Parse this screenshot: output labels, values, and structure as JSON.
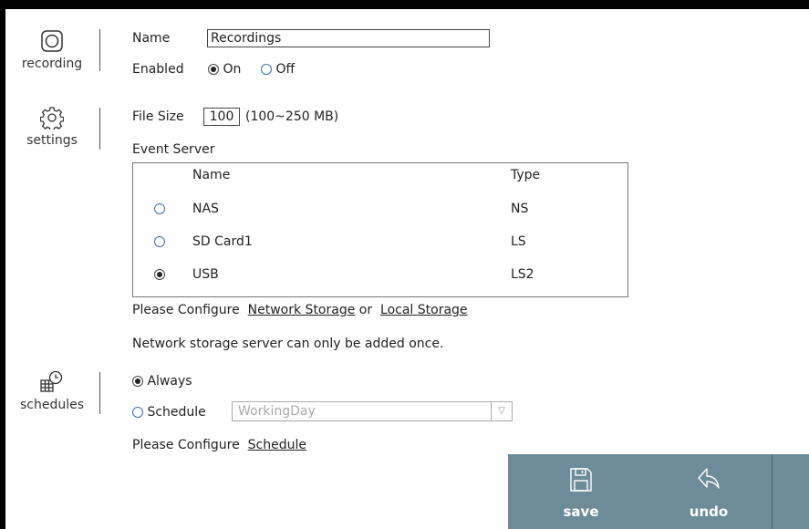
{
  "sections": {
    "recording": {
      "label": "recording",
      "icon": "record-icon"
    },
    "settings": {
      "label": "settings",
      "icon": "gear-icon"
    },
    "schedules": {
      "label": "schedules",
      "icon": "calendar-clock-icon"
    }
  },
  "recording": {
    "name_label": "Name",
    "name_value": "Recordings",
    "enabled_label": "Enabled",
    "on_label": "On",
    "off_label": "Off",
    "enabled": "On"
  },
  "settings": {
    "file_size_label": "File Size",
    "file_size_value": "100",
    "file_size_range": "(100~250 MB)",
    "event_server_label": "Event Server",
    "table": {
      "headers": [
        "Name",
        "Type"
      ],
      "rows": [
        {
          "name": "NAS",
          "type": "NS",
          "selected": false
        },
        {
          "name": "SD Card1",
          "type": "LS",
          "selected": false
        },
        {
          "name": "USB",
          "type": "LS2",
          "selected": true
        }
      ]
    },
    "configure_prefix": "Please Configure",
    "network_storage_link": "Network Storage",
    "or_text": "or",
    "local_storage_link": "Local Storage",
    "note": "Network storage server can only be added once."
  },
  "schedules": {
    "always_label": "Always",
    "schedule_label": "Schedule",
    "schedule_value": "WorkingDay",
    "selected": "Always",
    "configure_prefix": "Please Configure",
    "schedule_link": "Schedule"
  },
  "footer": {
    "save_label": "save",
    "undo_label": "undo",
    "save_icon": "floppy-disk-icon",
    "undo_icon": "undo-arrow-icon",
    "background": "#6d8b99"
  }
}
